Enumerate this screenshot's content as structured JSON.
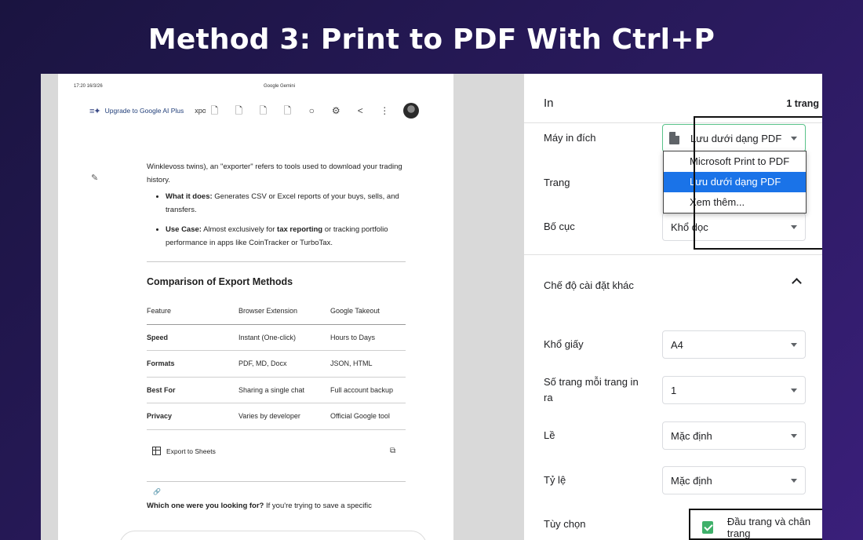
{
  "headline": "Method 3: Print to PDF With Ctrl+P",
  "preview": {
    "timestamp": "17:20 16/3/26",
    "page_title": "Google Gemini",
    "topbar": {
      "upgrade_label": "Upgrade to Google AI Plus",
      "export_fragment": "xpo"
    },
    "intro_text": "Winklevoss twins), an \"exporter\" refers to tools used to download your trading history.",
    "bullets": [
      {
        "bold": "What it does:",
        "text": " Generates CSV or Excel reports of your buys, sells, and transfers."
      },
      {
        "bold": "Use Case:",
        "text_before": " Almost exclusively for ",
        "bold2": "tax reporting",
        "text_after": " or tracking portfolio performance in apps like CoinTracker or TurboTax."
      }
    ],
    "comparison_heading": "Comparison of Export Methods",
    "table": {
      "headers": [
        "Feature",
        "Browser Extension",
        "Google Takeout"
      ],
      "rows": [
        [
          "Speed",
          "Instant (One-click)",
          "Hours to Days"
        ],
        [
          "Formats",
          "PDF, MD, Docx",
          "JSON, HTML"
        ],
        [
          "Best For",
          "Sharing a single chat",
          "Full account backup"
        ],
        [
          "Privacy",
          "Varies by developer",
          "Official Google tool"
        ]
      ]
    },
    "export_to_sheets": "Export to Sheets",
    "cut_text_bold": "Which one were you looking for?",
    "cut_text_rest": " If you're trying to save a specific"
  },
  "panel": {
    "title": "In",
    "page_count": "1 trang",
    "destination_label": "Máy in đích",
    "destination_value": "Lưu dưới dạng PDF",
    "destination_options": [
      "Microsoft Print to PDF",
      "Lưu dưới dạng PDF",
      "Xem thêm..."
    ],
    "destination_selected_index": 1,
    "pages_label": "Trang",
    "layout_label": "Bố cục",
    "layout_value": "Khổ dọc",
    "more_settings_label": "Chế độ cài đặt khác",
    "paper_size_label": "Khổ giấy",
    "paper_size_value": "A4",
    "pages_per_sheet_label": "Số trang mỗi trang in ra",
    "pages_per_sheet_value": "1",
    "margins_label": "Lề",
    "margins_value": "Mặc định",
    "scale_label": "Tỷ lệ",
    "scale_value": "Mặc định",
    "options_label": "Tùy chọn",
    "headers_footers_label": "Đầu trang và chân trang",
    "headers_footers_checked": true
  },
  "colors": {
    "checkbox": "#3fb06a",
    "dropdown_active": "#1a73e8",
    "destination_border": "#5ac28a"
  }
}
